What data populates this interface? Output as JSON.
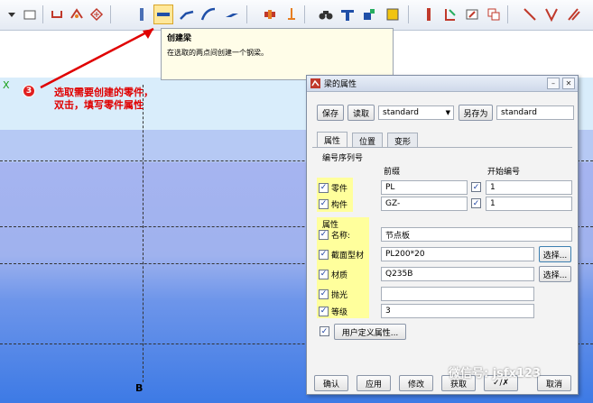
{
  "toolbar": {
    "icons": [
      "dropdown-icon",
      "select-window-icon",
      "weld-icon",
      "component-icon",
      "hatch-icon",
      "column-icon",
      "create-beam-icon",
      "polybeam-icon",
      "curved-beam-icon",
      "plate-icon",
      "bolt-icon",
      "anchor-icon",
      "binoculars-icon",
      "cut-icon",
      "fitting-icon",
      "plate-yellow-icon",
      "rebar-icon",
      "rebar-bend-icon",
      "edit-icon",
      "copy-icon",
      "line-icon",
      "angle-icon",
      "slash-icon"
    ]
  },
  "tooltip": {
    "title": "创建梁",
    "description": "在选取的两点间创建一个钢梁。"
  },
  "annotation": {
    "badge": "3",
    "line1": "选取需要创建的零件，",
    "line2": "双击，填写零件属性"
  },
  "canvas": {
    "axis_label": "B",
    "green_mark": "X"
  },
  "dialog": {
    "title": "梁的属性",
    "save_label": "保存",
    "load_label": "读取",
    "preset_value": "standard",
    "save_as_label": "另存为",
    "save_as_value": "standard",
    "tabs": [
      {
        "label": "属性",
        "active": true
      },
      {
        "label": "位置",
        "active": false
      },
      {
        "label": "变形",
        "active": false
      }
    ],
    "numbering": {
      "group_label": "编号序列号",
      "prefix_header": "前缀",
      "start_header": "开始编号",
      "rows": [
        {
          "label": "零件",
          "prefix": "PL",
          "start": "1"
        },
        {
          "label": "构件",
          "prefix": "GZ-",
          "start": "1"
        }
      ]
    },
    "attributes": {
      "group_label": "属性",
      "name_label": "名称:",
      "name_value": "节点板",
      "profile_label": "截面型材",
      "profile_value": "PL200*20",
      "material_label": "材质",
      "material_value": "Q235B",
      "finish_label": "抛光",
      "finish_value": "",
      "class_label": "等级",
      "class_value": "3",
      "select_label": "选择..."
    },
    "udf_label": "用户定义属性...",
    "footer": {
      "ok": "确认",
      "apply": "应用",
      "modify": "修改",
      "get": "获取",
      "toggle": "✓/✗",
      "cancel": "取消"
    }
  },
  "watermark": "微信号: jsfx123",
  "colors": {
    "accent_red": "#e00000",
    "tooltip_bg": "#fffde8",
    "highlight_yellow": "#ffff9c",
    "canvas_blue": "#3d7ae5"
  }
}
